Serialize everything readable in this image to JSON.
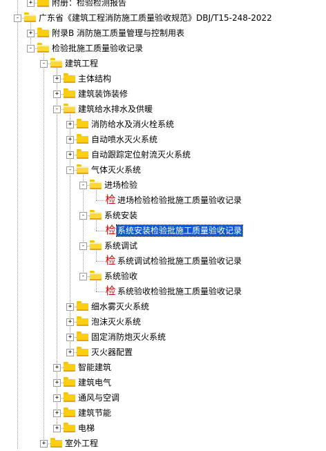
{
  "tree": {
    "items": [
      {
        "label": "附册：检验检测报告",
        "type": "folder",
        "level": 1,
        "expander": "+",
        "open": false
      },
      {
        "label": "广东省《建筑工程消防施工质量验收规范》DBJ/T15-248-2022",
        "type": "folder",
        "level": 0,
        "expander": "-",
        "open": true
      },
      {
        "label": "附录B 消防施工质量管理与控制用表",
        "type": "folder",
        "level": 1,
        "expander": "+",
        "open": false
      },
      {
        "label": "检验批施工质量验收记录",
        "type": "folder",
        "level": 1,
        "expander": "-",
        "open": true
      },
      {
        "label": "建筑工程",
        "type": "folder",
        "level": 2,
        "expander": "-",
        "open": true
      },
      {
        "label": "主体结构",
        "type": "folder",
        "level": 3,
        "expander": "+",
        "open": false
      },
      {
        "label": "建筑装饰装修",
        "type": "folder",
        "level": 3,
        "expander": "+",
        "open": false
      },
      {
        "label": "建筑给水排水及供暖",
        "type": "folder",
        "level": 3,
        "expander": "-",
        "open": true
      },
      {
        "label": "消防给水及消火栓系统",
        "type": "folder",
        "level": 4,
        "expander": "+",
        "open": false
      },
      {
        "label": "自动喷水灭火系统",
        "type": "folder",
        "level": 4,
        "expander": "+",
        "open": false
      },
      {
        "label": "自动跟踪定位射流灭火系统",
        "type": "folder",
        "level": 4,
        "expander": "+",
        "open": false
      },
      {
        "label": "气体灭火系统",
        "type": "folder",
        "level": 4,
        "expander": "-",
        "open": true
      },
      {
        "label": "进场检验",
        "type": "folder",
        "level": 5,
        "expander": "-",
        "open": true
      },
      {
        "label": "进场检验检验批施工质量验收记录",
        "type": "doc",
        "level": 6,
        "icon_char": "检"
      },
      {
        "label": "系统安装",
        "type": "folder",
        "level": 5,
        "expander": "-",
        "open": true
      },
      {
        "label": "系统安装检验批施工质量验收记录",
        "type": "doc",
        "level": 6,
        "icon_char": "检",
        "selected": true
      },
      {
        "label": "系统调试",
        "type": "folder",
        "level": 5,
        "expander": "-",
        "open": true
      },
      {
        "label": "系统调试检验批施工质量验收记录",
        "type": "doc",
        "level": 6,
        "icon_char": "检"
      },
      {
        "label": "系统验收",
        "type": "folder",
        "level": 5,
        "expander": "-",
        "open": true
      },
      {
        "label": "系统验收检验批施工质量验收记录",
        "type": "doc",
        "level": 6,
        "icon_char": "检"
      },
      {
        "label": "细水雾灭火系统",
        "type": "folder",
        "level": 4,
        "expander": "+",
        "open": false
      },
      {
        "label": "泡沫灭火系统",
        "type": "folder",
        "level": 4,
        "expander": "+",
        "open": false
      },
      {
        "label": "固定消防炮灭火系统",
        "type": "folder",
        "level": 4,
        "expander": "+",
        "open": false
      },
      {
        "label": "灭火器配置",
        "type": "folder",
        "level": 4,
        "expander": "+",
        "open": false
      },
      {
        "label": "智能建筑",
        "type": "folder",
        "level": 3,
        "expander": "+",
        "open": false
      },
      {
        "label": "建筑电气",
        "type": "folder",
        "level": 3,
        "expander": "+",
        "open": false
      },
      {
        "label": "通风与空调",
        "type": "folder",
        "level": 3,
        "expander": "+",
        "open": false
      },
      {
        "label": "建筑节能",
        "type": "folder",
        "level": 3,
        "expander": "+",
        "open": false
      },
      {
        "label": "电梯",
        "type": "folder",
        "level": 3,
        "expander": "+",
        "open": false
      },
      {
        "label": "室外工程",
        "type": "folder",
        "level": 2,
        "expander": "+",
        "open": false
      }
    ]
  },
  "colors": {
    "selection_background": "#0a58d6",
    "selection_text": "#ffffff",
    "doc_icon": "#d40000",
    "folder": "#fbcf11",
    "guide_line": "#9a9a9a"
  }
}
